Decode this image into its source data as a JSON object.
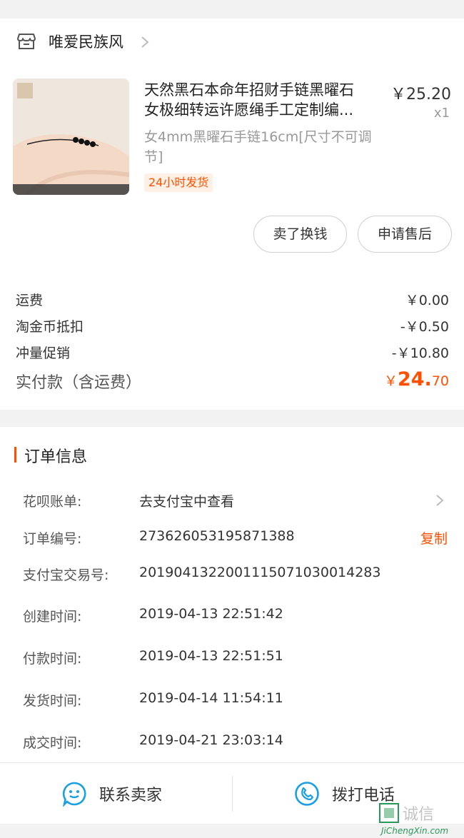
{
  "shop": {
    "name": "唯爱民族风"
  },
  "product": {
    "title_line1": "天然黑石本命年招财手链黑曜石",
    "title_line2": "女极细转运许愿绳手工定制编...",
    "price": "￥25.20",
    "quantity": "x1",
    "spec": "女4mm黑曜石手链16cm[尺寸不可调节]",
    "tag": "24小时发货"
  },
  "actions": {
    "sell_label": "卖了换钱",
    "aftersale_label": "申请售后"
  },
  "fees": [
    {
      "label": "运费",
      "value": "￥0.00"
    },
    {
      "label": "淘金币抵扣",
      "value": "-￥0.50"
    },
    {
      "label": "冲量促销",
      "value": "-￥10.80"
    }
  ],
  "paid": {
    "label": "实付款（含运费）",
    "symbol": "￥",
    "integer": "24.",
    "decimal": "70"
  },
  "order_info": {
    "title": "订单信息",
    "huabei_label": "花呗账单:",
    "huabei_value": "去支付宝中查看",
    "order_no_label": "订单编号:",
    "order_no_value": "273626053195871388",
    "copy_label": "复制",
    "alipay_label": "支付宝交易号:",
    "alipay_value": "2019041322001115071030014283",
    "created_label": "创建时间:",
    "created_value": "2019-04-13 22:51:42",
    "paid_time_label": "付款时间:",
    "paid_time_value": "2019-04-13 22:51:51",
    "shipped_label": "发货时间:",
    "shipped_value": "2019-04-14 11:54:11",
    "completed_label": "成交时间:",
    "completed_value": "2019-04-21 23:03:14"
  },
  "bottom": {
    "contact_label": "联系卖家",
    "call_label": "拨打电话"
  },
  "watermark": {
    "text": "集诚信",
    "url": "JiChengXin.com"
  },
  "colors": {
    "accent": "#ff5000",
    "icon_blue": "#1a9fe6"
  }
}
